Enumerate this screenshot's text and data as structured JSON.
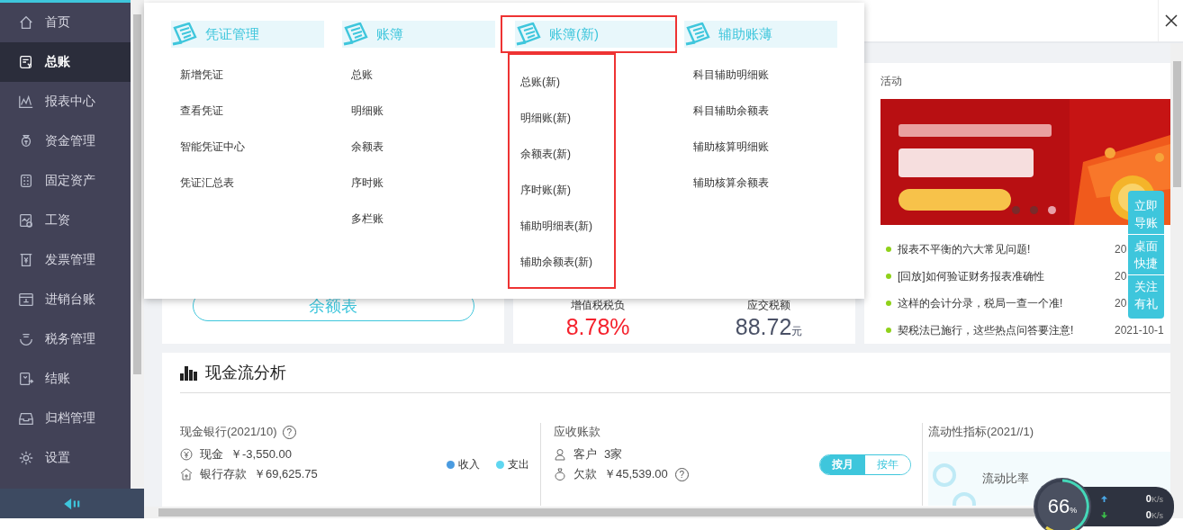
{
  "sidebar": {
    "items": [
      {
        "label": "首页",
        "selected": false
      },
      {
        "label": "总账",
        "selected": true
      },
      {
        "label": "报表中心",
        "selected": false
      },
      {
        "label": "资金管理",
        "selected": false
      },
      {
        "label": "固定资产",
        "selected": false
      },
      {
        "label": "工资",
        "selected": false
      },
      {
        "label": "发票管理",
        "selected": false
      },
      {
        "label": "进销台账",
        "selected": false
      },
      {
        "label": "税务管理",
        "selected": false
      },
      {
        "label": "结账",
        "selected": false
      },
      {
        "label": "归档管理",
        "selected": false
      },
      {
        "label": "设置",
        "selected": false
      }
    ]
  },
  "mega_menu": {
    "columns": [
      {
        "title": "凭证管理",
        "highlighted": false,
        "items": [
          "新增凭证",
          "查看凭证",
          "智能凭证中心",
          "凭证汇总表"
        ]
      },
      {
        "title": "账簿",
        "highlighted": false,
        "items": [
          "总账",
          "明细账",
          "余额表",
          "序时账",
          "多栏账"
        ]
      },
      {
        "title": "账簿(新)",
        "highlighted": true,
        "items": [
          "总账(新)",
          "明细账(新)",
          "余额表(新)",
          "序时账(新)",
          "辅助明细表(新)",
          "辅助余额表(新)"
        ]
      },
      {
        "title": "辅助账薄",
        "highlighted": false,
        "items": [
          "科目辅助明细账",
          "科目辅助余额表",
          "辅助核算明细账",
          "辅助核算余额表"
        ]
      }
    ]
  },
  "balance_button": {
    "label": "余额表"
  },
  "tax_stats": [
    {
      "label": "增值税税负",
      "value": "8.78%",
      "kind": "alert"
    },
    {
      "label": "应交税额",
      "value": "88.72",
      "unit": "元",
      "kind": "normal"
    }
  ],
  "activity": {
    "title": "活动",
    "dots": [
      {
        "selected": false
      },
      {
        "selected": false
      },
      {
        "selected": true
      }
    ],
    "news": [
      {
        "title": "报表不平衡的六大常见问题!",
        "date": "20"
      },
      {
        "title": "[回放]如何验证财务报表准确性",
        "date": "20"
      },
      {
        "title": "这样的会计分录，税局一查一个准!",
        "date": "20"
      },
      {
        "title": "契税法已施行，这些热点问答要注意!",
        "date": "2021-10-1"
      }
    ]
  },
  "float_buttons": [
    "立即导账",
    "桌面快捷",
    "关注有礼"
  ],
  "cash_flow": {
    "title": "现金流分析",
    "cash_bank": {
      "title": "现金银行(2021/10)",
      "help": "?",
      "rows": [
        {
          "label": "现金",
          "value": "￥-3,550.00"
        },
        {
          "label": "银行存款",
          "value": "￥69,625.75"
        }
      ],
      "legend": [
        {
          "label": "收入",
          "color": "#4a9be0"
        },
        {
          "label": "支出",
          "color": "#5fd6f0"
        }
      ]
    },
    "receivables": {
      "title": "应收账款",
      "rows": [
        {
          "label": "客户",
          "value": "3家"
        },
        {
          "label": "欠款",
          "value": "￥45,539.00",
          "help": "?"
        }
      ],
      "toggle": [
        {
          "label": "按月",
          "selected": true
        },
        {
          "label": "按年",
          "selected": false
        }
      ]
    },
    "liquidity": {
      "title": "流动性指标(2021//1)",
      "metric": "流动比率"
    }
  },
  "speed_widget": {
    "percent": "66",
    "unit": "%",
    "up": "0",
    "up_unit": "K/s",
    "down": "0",
    "down_unit": "K/s"
  }
}
